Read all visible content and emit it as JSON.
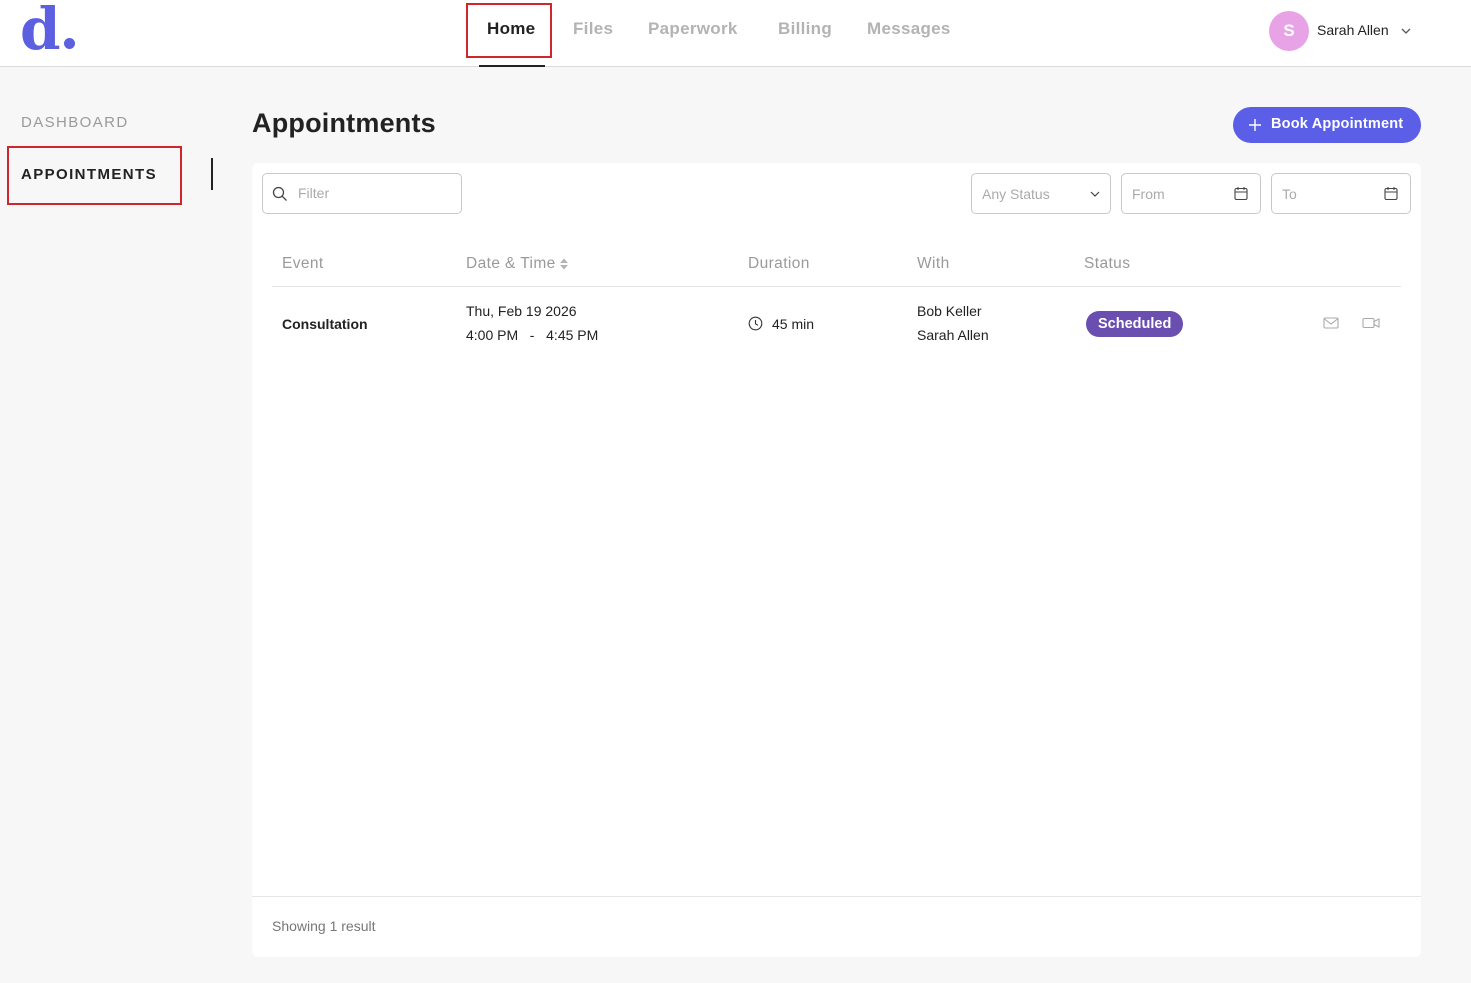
{
  "brand": {
    "logo_text": "d",
    "accent_color": "#5b5fe0"
  },
  "nav": {
    "items": [
      {
        "label": "Home",
        "active": true
      },
      {
        "label": "Files"
      },
      {
        "label": "Paperwork"
      },
      {
        "label": "Billing"
      },
      {
        "label": "Messages"
      }
    ]
  },
  "user": {
    "initial": "S",
    "name": "Sarah Allen",
    "avatar_color": "#e8a3e6",
    "icon": "chevron-down-icon"
  },
  "sidebar": {
    "items": [
      {
        "label": "DASHBOARD"
      },
      {
        "label": "APPOINTMENTS",
        "active": true
      }
    ]
  },
  "page": {
    "title": "Appointments",
    "book_button": "Book Appointment",
    "book_button_color": "#5b5fe8"
  },
  "filters": {
    "filter_placeholder": "Filter",
    "status_value": "Any Status",
    "from_placeholder": "From",
    "to_placeholder": "To"
  },
  "table": {
    "headers": [
      "Event",
      "Date & Time",
      "Duration",
      "With",
      "Status"
    ],
    "rows": [
      {
        "event": "Consultation",
        "date": "Thu, Feb 19 2026",
        "time": "4:00 PM   -   4:45 PM",
        "duration": "45 min",
        "with": [
          "Bob Keller",
          "Sarah Allen"
        ],
        "status": "Scheduled",
        "status_color": "#6a4fb0",
        "actions": [
          "mail-icon",
          "video-icon"
        ]
      }
    ]
  },
  "footer": {
    "showing": "Showing 1 result"
  }
}
